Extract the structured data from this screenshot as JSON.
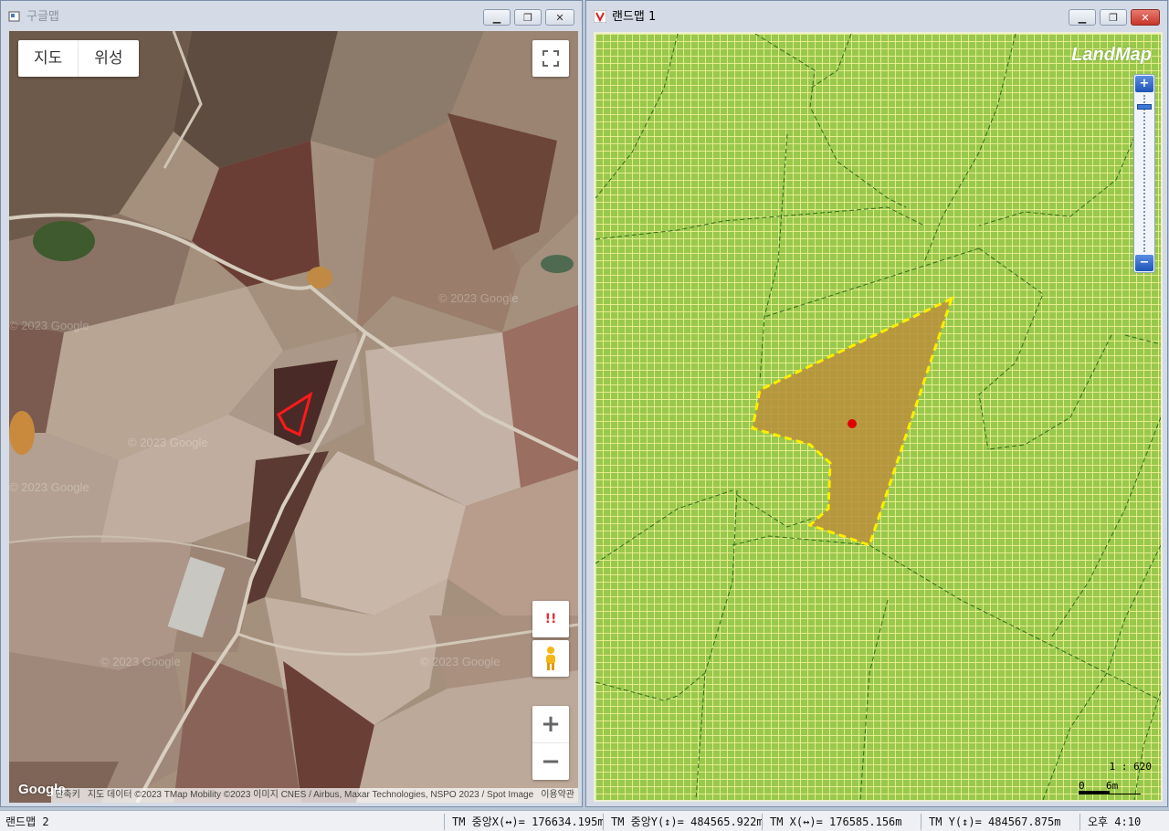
{
  "google_window": {
    "title": "구글맵",
    "map_type_buttons": [
      "지도",
      "위성"
    ],
    "watermark": "© 2023 Google",
    "attribution": {
      "shortcuts": "단축키",
      "data": "지도 데이터 ©2023 TMap Mobility ©2023 이미지 CNES / Airbus, Maxar Technologies, NSPO 2023 / Spot Image",
      "terms": "이용약관"
    },
    "logo": "Google",
    "controls": {
      "fullscreen_icon": "fullscreen-icon",
      "warning_label": "!!",
      "pegman_icon": "pegman-icon",
      "zoom_in": "+",
      "zoom_out": "−"
    }
  },
  "land_window": {
    "title": "랜드맵 1",
    "logo": "LandMap",
    "zoom": {
      "in_label": "+",
      "out_label": "−",
      "level_fraction": 0.06
    },
    "scale": {
      "ratio": "1 : 620",
      "start": "0",
      "end": "6m"
    }
  },
  "status_bar": {
    "window_name": "랜드맵 2",
    "tm_center_x": "TM 중앙X(↔)= 176634.195m",
    "tm_center_y": "TM 중앙Y(↕)= 484565.922m",
    "tm_x": "TM X(↔)= 176585.156m",
    "tm_y": "TM Y(↕)= 484567.875m",
    "time": "오후 4:10"
  },
  "colors": {
    "parcel_fill": "#b8913c",
    "parcel_outline": "#ffee00",
    "marker": "#e00000",
    "grid_background": "#98c84c",
    "highlight_outline": "#ff1a1a"
  }
}
